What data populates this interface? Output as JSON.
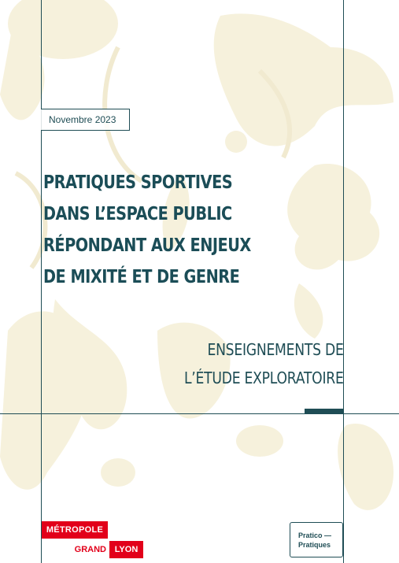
{
  "date": "Novembre 2023",
  "title_lines": [
    "PRATIQUES SPORTIVES",
    "DANS L’ESPACE PUBLIC",
    "RÉPONDANT AUX ENJEUX",
    "DE MIXITÉ ET DE GENRE"
  ],
  "subtitle_lines": [
    "ENSEIGNEMENTS DE",
    "L’ÉTUDE EXPLORATOIRE"
  ],
  "logo_metropole": {
    "line1": "MÉTROPOLE",
    "grand": "GRAND",
    "lyon": "LYON"
  },
  "logo_pratico": {
    "line1": "Pratico —",
    "line2": "Pratiques"
  },
  "colors": {
    "primary": "#1f4d55",
    "decor": "#f5f0da",
    "brand_red": "#e2001a"
  }
}
